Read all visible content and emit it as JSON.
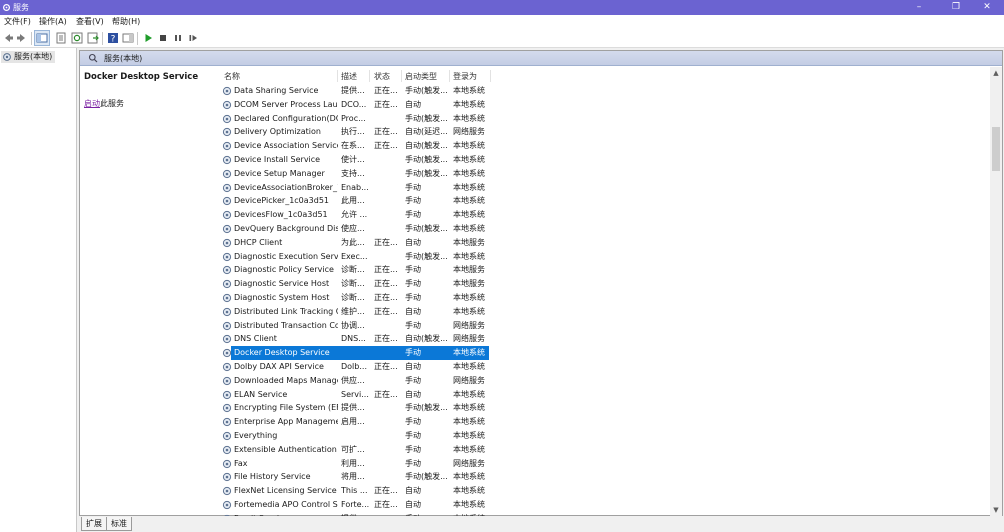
{
  "window": {
    "title": "服务"
  },
  "menu": [
    "文件(F)",
    "操作(A)",
    "查看(V)",
    "帮助(H)"
  ],
  "tree": {
    "node_label": "服务(本地)"
  },
  "header": {
    "title": "服务(本地)"
  },
  "detail": {
    "service_name": "Docker Desktop Service",
    "action_link": "启动",
    "action_suffix": "此服务"
  },
  "columns": [
    "名称",
    "描述",
    "状态",
    "启动类型",
    "登录为"
  ],
  "services": [
    {
      "name": "Data Sharing Service",
      "desc": "提供...",
      "status": "正在...",
      "startup": "手动(触发...",
      "logon": "本地系统"
    },
    {
      "name": "DCOM Server Process Lau...",
      "desc": "DCO...",
      "status": "正在...",
      "startup": "自动",
      "logon": "本地系统"
    },
    {
      "name": "Declared Configuration(DC...",
      "desc": "Proc...",
      "status": "",
      "startup": "手动(触发...",
      "logon": "本地系统"
    },
    {
      "name": "Delivery Optimization",
      "desc": "执行...",
      "status": "正在...",
      "startup": "自动(延迟...",
      "logon": "网络服务"
    },
    {
      "name": "Device Association Service",
      "desc": "在系...",
      "status": "正在...",
      "startup": "自动(触发...",
      "logon": "本地系统"
    },
    {
      "name": "Device Install Service",
      "desc": "使计...",
      "status": "",
      "startup": "手动(触发...",
      "logon": "本地系统"
    },
    {
      "name": "Device Setup Manager",
      "desc": "支持...",
      "status": "",
      "startup": "手动(触发...",
      "logon": "本地系统"
    },
    {
      "name": "DeviceAssociationBroker_1...",
      "desc": "Enab...",
      "status": "",
      "startup": "手动",
      "logon": "本地系统"
    },
    {
      "name": "DevicePicker_1c0a3d51",
      "desc": "此用...",
      "status": "",
      "startup": "手动",
      "logon": "本地系统"
    },
    {
      "name": "DevicesFlow_1c0a3d51",
      "desc": "允许 ...",
      "status": "",
      "startup": "手动",
      "logon": "本地系统"
    },
    {
      "name": "DevQuery Background Dis...",
      "desc": "使应...",
      "status": "",
      "startup": "手动(触发...",
      "logon": "本地系统"
    },
    {
      "name": "DHCP Client",
      "desc": "为此...",
      "status": "正在...",
      "startup": "自动",
      "logon": "本地服务"
    },
    {
      "name": "Diagnostic Execution Service",
      "desc": "Exec...",
      "status": "",
      "startup": "手动(触发...",
      "logon": "本地系统"
    },
    {
      "name": "Diagnostic Policy Service",
      "desc": "诊断...",
      "status": "正在...",
      "startup": "手动",
      "logon": "本地服务"
    },
    {
      "name": "Diagnostic Service Host",
      "desc": "诊断...",
      "status": "正在...",
      "startup": "手动",
      "logon": "本地服务"
    },
    {
      "name": "Diagnostic System Host",
      "desc": "诊断...",
      "status": "正在...",
      "startup": "手动",
      "logon": "本地系统"
    },
    {
      "name": "Distributed Link Tracking C...",
      "desc": "维护...",
      "status": "正在...",
      "startup": "自动",
      "logon": "本地系统"
    },
    {
      "name": "Distributed Transaction Co...",
      "desc": "协调...",
      "status": "",
      "startup": "手动",
      "logon": "网络服务"
    },
    {
      "name": "DNS Client",
      "desc": "DNS...",
      "status": "正在...",
      "startup": "自动(触发...",
      "logon": "网络服务"
    },
    {
      "name": "Docker Desktop Service",
      "desc": "",
      "status": "",
      "startup": "手动",
      "logon": "本地系统",
      "selected": true
    },
    {
      "name": "Dolby DAX API Service",
      "desc": "Dolb...",
      "status": "正在...",
      "startup": "自动",
      "logon": "本地系统"
    },
    {
      "name": "Downloaded Maps Manager",
      "desc": "供应...",
      "status": "",
      "startup": "手动",
      "logon": "网络服务"
    },
    {
      "name": "ELAN Service",
      "desc": "Servi...",
      "status": "正在...",
      "startup": "自动",
      "logon": "本地系统"
    },
    {
      "name": "Encrypting File System (EFS)",
      "desc": "提供...",
      "status": "",
      "startup": "手动(触发...",
      "logon": "本地系统"
    },
    {
      "name": "Enterprise App Manageme...",
      "desc": "启用...",
      "status": "",
      "startup": "手动",
      "logon": "本地系统"
    },
    {
      "name": "Everything",
      "desc": "",
      "status": "",
      "startup": "手动",
      "logon": "本地系统"
    },
    {
      "name": "Extensible Authentication ...",
      "desc": "可扩...",
      "status": "",
      "startup": "手动",
      "logon": "本地系统"
    },
    {
      "name": "Fax",
      "desc": "利用...",
      "status": "",
      "startup": "手动",
      "logon": "网络服务"
    },
    {
      "name": "File History Service",
      "desc": "将用...",
      "status": "",
      "startup": "手动(触发...",
      "logon": "本地系统"
    },
    {
      "name": "FlexNet Licensing Service",
      "desc": "This ...",
      "status": "正在...",
      "startup": "自动",
      "logon": "本地系统"
    },
    {
      "name": "Fortemedia APO Control S...",
      "desc": "Forte...",
      "status": "正在...",
      "startup": "自动",
      "logon": "本地系统"
    },
    {
      "name": "Fraxit Service",
      "desc": "提供...",
      "status": "",
      "startup": "手动",
      "logon": "本地系统"
    }
  ],
  "tabs": [
    "扩展",
    "标准"
  ]
}
